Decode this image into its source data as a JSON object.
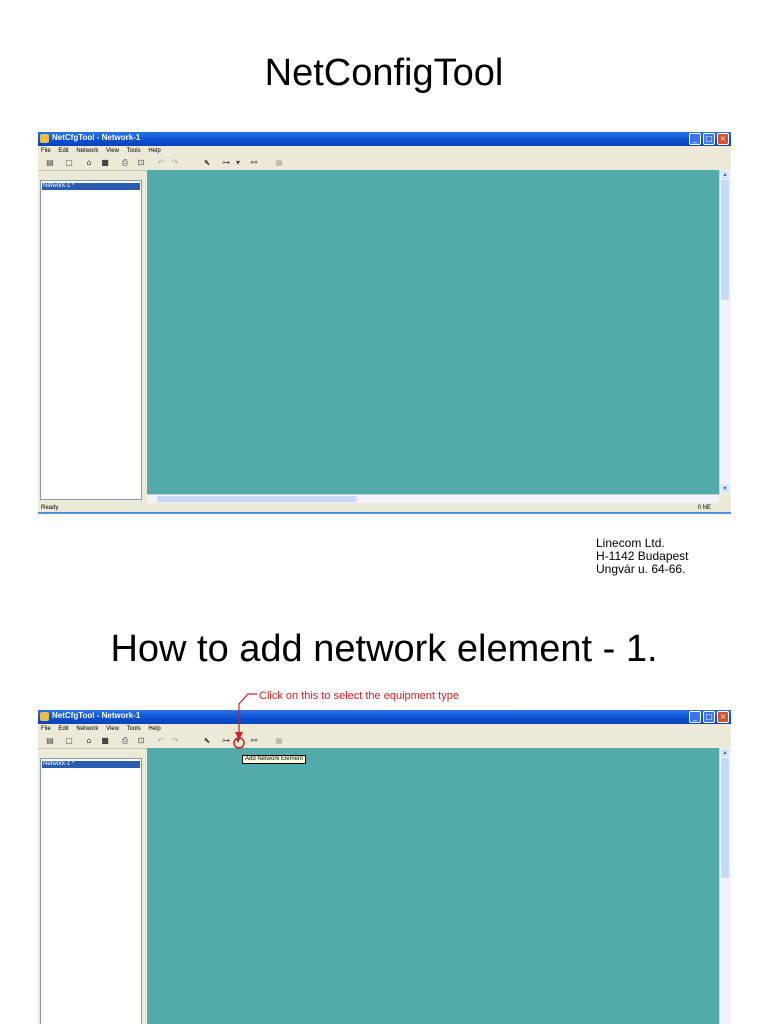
{
  "slide1": {
    "title": "NetConfigTool"
  },
  "slide2": {
    "title": "How to add network element - 1."
  },
  "window": {
    "title": "NetCfgTool - Network-1",
    "menu": [
      "File",
      "Edit",
      "Network",
      "View",
      "Tools",
      "Help"
    ],
    "tree_item": "Network-1 *",
    "status": "Ready",
    "status_right": "0 NE",
    "canvas_color": "#52aaaa"
  },
  "company": {
    "name": "Linecom Ltd.",
    "city": "H-1142 Budapest",
    "street": "Ungvár u. 64-66."
  },
  "annotation": {
    "text": "Click on this to select the equipment type",
    "tooltip": "Add Network Element",
    "color": "#d42020"
  },
  "icons": [
    "list-icon",
    "new-file-icon",
    "open-icon",
    "save-icon",
    "print-icon",
    "preview-icon",
    "undo-icon",
    "redo-icon",
    "pointer-icon",
    "add-network-element-icon",
    "dropdown-arrow-icon",
    "connect-icon",
    "properties-icon"
  ]
}
